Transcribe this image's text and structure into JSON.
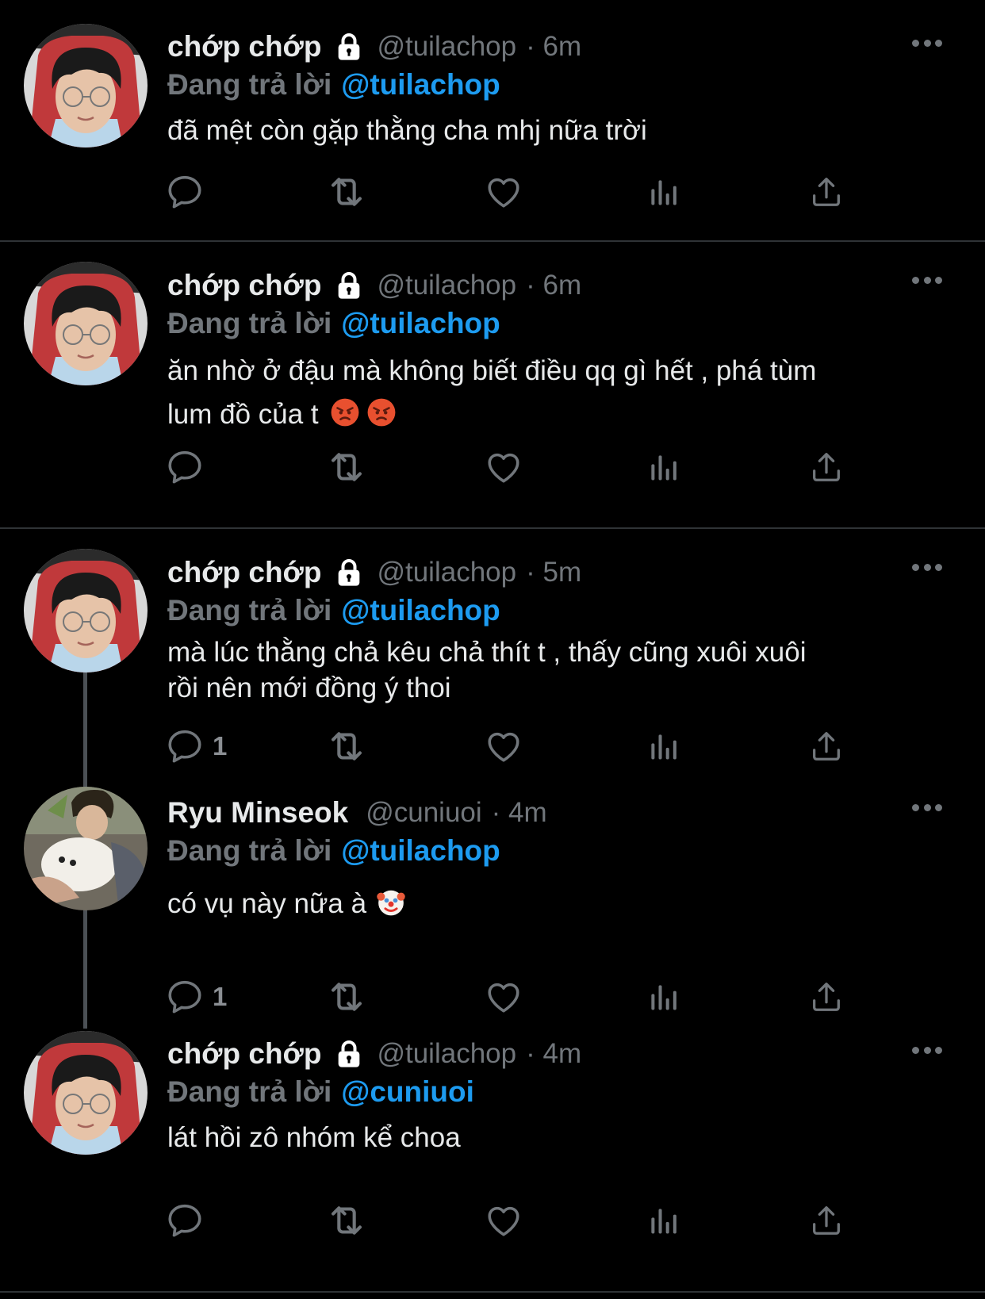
{
  "colors": {
    "background": "#000000",
    "text": "#e7e9ea",
    "secondary": "#71767b",
    "accent": "#1d9bf0",
    "divider": "#2f3336"
  },
  "tweets": [
    {
      "name": "chớp chớp",
      "locked": true,
      "handle": "@tuilachop",
      "time": "· 6m",
      "replying_label": "Đang trả lời",
      "replying_to": "@tuilachop",
      "text": "đã mệt còn gặp thằng cha mhj nữa trời",
      "emojis": [],
      "reply_count": ""
    },
    {
      "name": "chớp chớp",
      "locked": true,
      "handle": "@tuilachop",
      "time": "· 6m",
      "replying_label": "Đang trả lời",
      "replying_to": "@tuilachop",
      "text_line1": "ăn nhờ ở đậu mà không biết điều qq gì hết , phá tùm",
      "text_line2": "lum đồ của t",
      "emojis": [
        "angry-face-icon",
        "angry-face-icon"
      ],
      "reply_count": ""
    },
    {
      "name": "chớp chớp",
      "locked": true,
      "handle": "@tuilachop",
      "time": "· 5m",
      "replying_label": "Đang trả lời",
      "replying_to": "@tuilachop",
      "text_line1": "mà lúc thằng chả kêu chả thít t , thấy cũng xuôi xuôi",
      "text_line2": "rồi nên mới đồng ý thoi",
      "emojis": [],
      "reply_count": "1"
    },
    {
      "name": "Ryu Minseok",
      "locked": false,
      "handle": "@cuniuoi",
      "time": "· 4m",
      "replying_label": "Đang trả lời",
      "replying_to": "@tuilachop",
      "text": "có vụ này nữa à",
      "emojis": [
        "clown-face-icon"
      ],
      "reply_count": "1"
    },
    {
      "name": "chớp chớp",
      "locked": true,
      "handle": "@tuilachop",
      "time": "· 4m",
      "replying_label": "Đang trả lời",
      "replying_to": "@cuniuoi",
      "text": "lát hồi zô nhóm kể choa",
      "emojis": [],
      "reply_count": ""
    }
  ],
  "actions": [
    "reply-icon",
    "retweet-icon",
    "like-icon",
    "analytics-icon",
    "share-icon"
  ]
}
